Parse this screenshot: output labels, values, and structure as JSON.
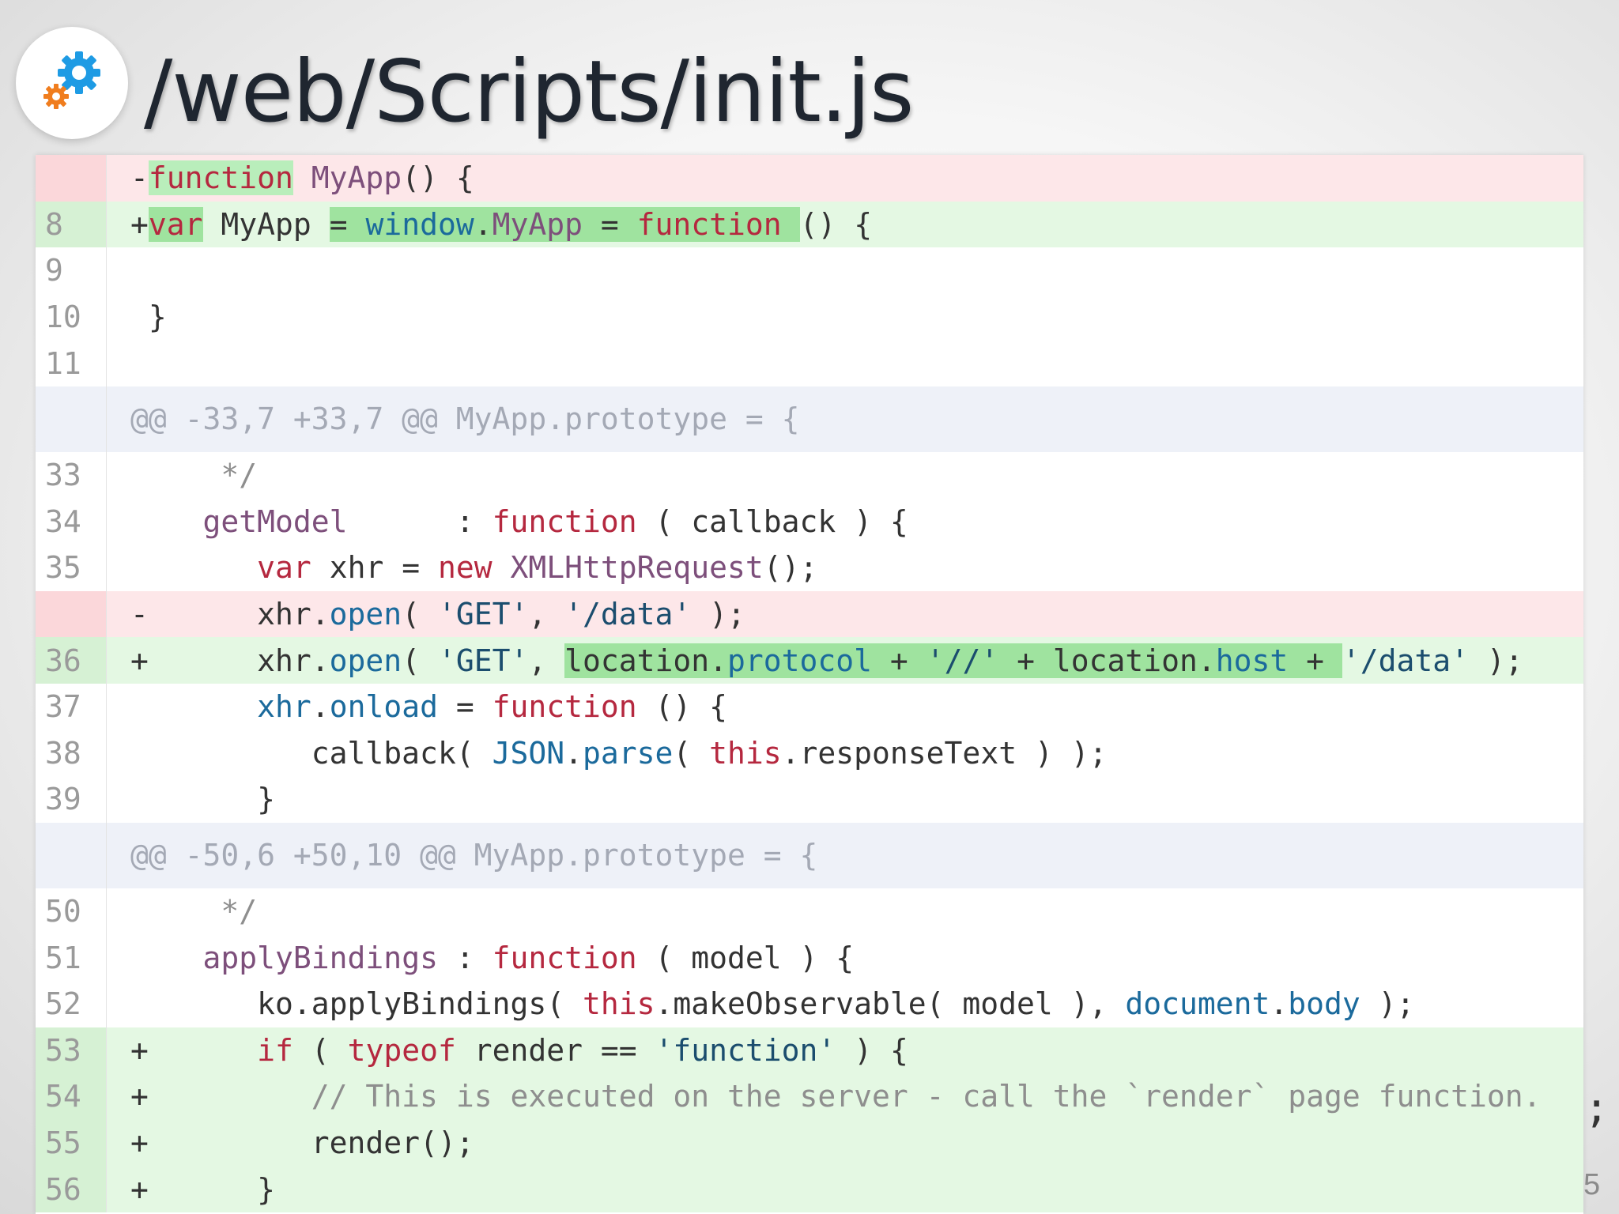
{
  "slide": {
    "title": "/web/Scripts/init.js",
    "icon": "gears-icon",
    "page_number": "5",
    "overflow_char": ";"
  },
  "diff": {
    "rows": [
      {
        "type": "del",
        "num": "",
        "sign": "-",
        "segments": [
          {
            "t": "function",
            "c": "k hl"
          },
          {
            "t": " MyApp",
            "c": "f"
          },
          {
            "t": "() {",
            "c": ""
          }
        ]
      },
      {
        "type": "add",
        "num": "8",
        "sign": "+",
        "segments": [
          {
            "t": "var",
            "c": "k hlg"
          },
          {
            "t": " MyApp ",
            "c": ""
          },
          {
            "t": "= ",
            "c": "hlg"
          },
          {
            "t": "window",
            "c": "b hlg"
          },
          {
            "t": ".",
            "c": "hlg"
          },
          {
            "t": "MyApp",
            "c": "f hlg"
          },
          {
            "t": " = ",
            "c": "hlg"
          },
          {
            "t": "function",
            "c": "k hlg"
          },
          {
            "t": " ",
            "c": "hlg"
          },
          {
            "t": "() {",
            "c": ""
          }
        ]
      },
      {
        "type": "ctx",
        "num": "9",
        "sign": "",
        "segments": []
      },
      {
        "type": "ctx",
        "num": "10",
        "sign": "",
        "segments": [
          {
            "t": "}",
            "c": ""
          }
        ]
      },
      {
        "type": "ctx",
        "num": "11",
        "sign": "",
        "segments": []
      },
      {
        "type": "hunk",
        "num": "",
        "sign": "",
        "segments": [
          {
            "t": "@@ -33,7 +33,7 @@ MyApp.prototype = {",
            "c": ""
          }
        ]
      },
      {
        "type": "ctx",
        "num": "33",
        "sign": "",
        "segments": [
          {
            "t": "    */",
            "c": "c"
          }
        ]
      },
      {
        "type": "ctx",
        "num": "34",
        "sign": "",
        "segments": [
          {
            "t": "   ",
            "c": ""
          },
          {
            "t": "getModel",
            "c": "f"
          },
          {
            "t": "      : ",
            "c": ""
          },
          {
            "t": "function",
            "c": "k"
          },
          {
            "t": " ( callback ) {",
            "c": ""
          }
        ]
      },
      {
        "type": "ctx",
        "num": "35",
        "sign": "",
        "segments": [
          {
            "t": "      ",
            "c": ""
          },
          {
            "t": "var",
            "c": "k"
          },
          {
            "t": " xhr = ",
            "c": ""
          },
          {
            "t": "new",
            "c": "k"
          },
          {
            "t": " ",
            "c": ""
          },
          {
            "t": "XMLHttpRequest",
            "c": "f"
          },
          {
            "t": "();",
            "c": ""
          }
        ]
      },
      {
        "type": "del",
        "num": "",
        "sign": "-",
        "segments": [
          {
            "t": "      xhr.",
            "c": ""
          },
          {
            "t": "open",
            "c": "b"
          },
          {
            "t": "( ",
            "c": ""
          },
          {
            "t": "'GET'",
            "c": "s"
          },
          {
            "t": ", ",
            "c": ""
          },
          {
            "t": "'/data'",
            "c": "s"
          },
          {
            "t": " );",
            "c": ""
          }
        ]
      },
      {
        "type": "add",
        "num": "36",
        "sign": "+",
        "segments": [
          {
            "t": "      xhr.",
            "c": ""
          },
          {
            "t": "open",
            "c": "b"
          },
          {
            "t": "( ",
            "c": ""
          },
          {
            "t": "'GET'",
            "c": "s"
          },
          {
            "t": ", ",
            "c": ""
          },
          {
            "t": "location.",
            "c": "hlg"
          },
          {
            "t": "protocol",
            "c": "b hlg"
          },
          {
            "t": " + ",
            "c": "hlg"
          },
          {
            "t": "'//'",
            "c": "s hlg"
          },
          {
            "t": " + location.",
            "c": "hlg"
          },
          {
            "t": "host",
            "c": "b hlg"
          },
          {
            "t": " + ",
            "c": "hlg"
          },
          {
            "t": "'/data'",
            "c": "s"
          },
          {
            "t": " );",
            "c": ""
          }
        ]
      },
      {
        "type": "ctx",
        "num": "37",
        "sign": "",
        "segments": [
          {
            "t": "      ",
            "c": ""
          },
          {
            "t": "xhr",
            "c": "b"
          },
          {
            "t": ".",
            "c": ""
          },
          {
            "t": "onload",
            "c": "b"
          },
          {
            "t": " = ",
            "c": ""
          },
          {
            "t": "function",
            "c": "k"
          },
          {
            "t": " () {",
            "c": ""
          }
        ]
      },
      {
        "type": "ctx",
        "num": "38",
        "sign": "",
        "segments": [
          {
            "t": "         callback( ",
            "c": ""
          },
          {
            "t": "JSON",
            "c": "b"
          },
          {
            "t": ".",
            "c": ""
          },
          {
            "t": "parse",
            "c": "b"
          },
          {
            "t": "( ",
            "c": ""
          },
          {
            "t": "this",
            "c": "k"
          },
          {
            "t": ".responseText ) );",
            "c": ""
          }
        ]
      },
      {
        "type": "ctx",
        "num": "39",
        "sign": "",
        "segments": [
          {
            "t": "      }",
            "c": ""
          }
        ]
      },
      {
        "type": "hunk",
        "num": "",
        "sign": "",
        "segments": [
          {
            "t": "@@ -50,6 +50,10 @@ MyApp.prototype = {",
            "c": ""
          }
        ]
      },
      {
        "type": "ctx",
        "num": "50",
        "sign": "",
        "segments": [
          {
            "t": "    */",
            "c": "c"
          }
        ]
      },
      {
        "type": "ctx",
        "num": "51",
        "sign": "",
        "segments": [
          {
            "t": "   ",
            "c": ""
          },
          {
            "t": "applyBindings",
            "c": "f"
          },
          {
            "t": " : ",
            "c": ""
          },
          {
            "t": "function",
            "c": "k"
          },
          {
            "t": " ( model ) {",
            "c": ""
          }
        ]
      },
      {
        "type": "ctx",
        "num": "52",
        "sign": "",
        "segments": [
          {
            "t": "      ko.applyBindings( ",
            "c": ""
          },
          {
            "t": "this",
            "c": "k"
          },
          {
            "t": ".makeObservable( model ), ",
            "c": ""
          },
          {
            "t": "document",
            "c": "b"
          },
          {
            "t": ".",
            "c": ""
          },
          {
            "t": "body",
            "c": "b"
          },
          {
            "t": " );",
            "c": ""
          }
        ]
      },
      {
        "type": "add",
        "num": "53",
        "sign": "+",
        "segments": [
          {
            "t": "      ",
            "c": ""
          },
          {
            "t": "if",
            "c": "k"
          },
          {
            "t": " ( ",
            "c": ""
          },
          {
            "t": "typeof",
            "c": "k"
          },
          {
            "t": " render == ",
            "c": ""
          },
          {
            "t": "'function'",
            "c": "s"
          },
          {
            "t": " ) {",
            "c": ""
          }
        ]
      },
      {
        "type": "add",
        "num": "54",
        "sign": "+",
        "segments": [
          {
            "t": "         // This is executed on the server - call the `render` page function.",
            "c": "c"
          }
        ]
      },
      {
        "type": "add",
        "num": "55",
        "sign": "+",
        "segments": [
          {
            "t": "         render();",
            "c": ""
          }
        ]
      },
      {
        "type": "add",
        "num": "56",
        "sign": "+",
        "segments": [
          {
            "t": "      }",
            "c": ""
          }
        ]
      }
    ]
  }
}
